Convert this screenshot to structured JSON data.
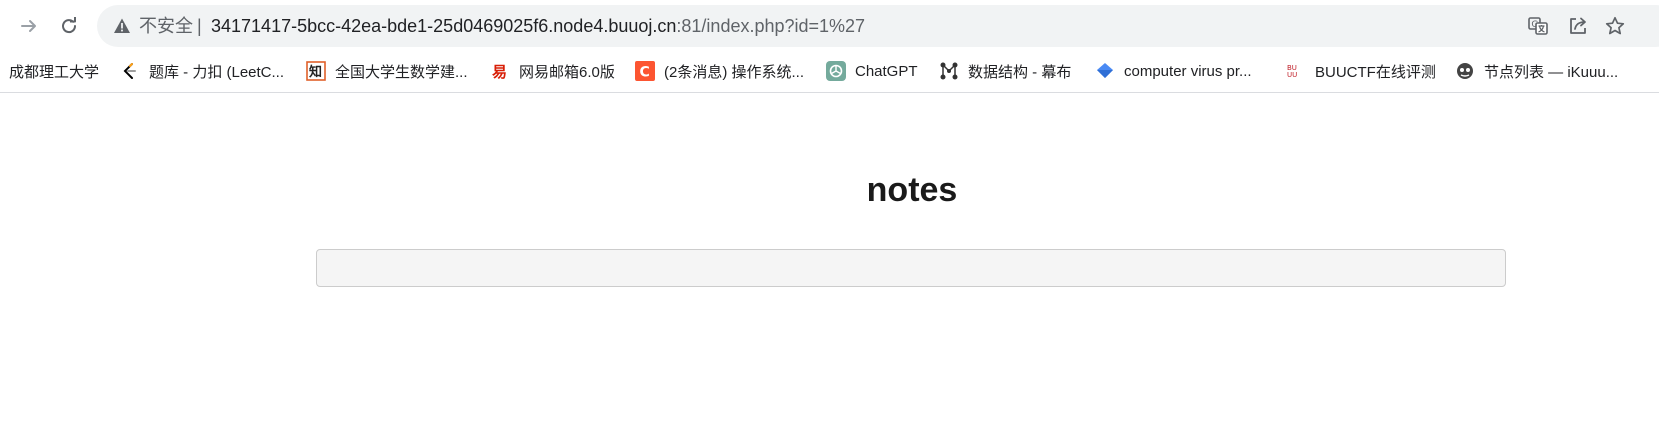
{
  "browser": {
    "security_label": "不安全",
    "separator": "|",
    "url_host": "34171417-5bcc-42ea-bde1-25d0469025f6.node4.buuoj.cn",
    "url_path": ":81/index.php?id=1%27",
    "icons": {
      "back": "arrow-right-icon",
      "reload": "reload-icon",
      "warning": "warning-icon",
      "translate": "translate-icon",
      "share": "share-icon",
      "star": "star-icon"
    }
  },
  "bookmarks": [
    {
      "label": "成都理工大学",
      "icon": "none"
    },
    {
      "label": "题库 - 力扣 (LeetC...",
      "icon": "leetcode-icon"
    },
    {
      "label": "全国大学生数学建...",
      "icon": "zhi-icon"
    },
    {
      "label": "网易邮箱6.0版",
      "icon": "netease-icon"
    },
    {
      "label": "(2条消息) 操作系统...",
      "icon": "csdn-icon"
    },
    {
      "label": "ChatGPT",
      "icon": "chatgpt-icon"
    },
    {
      "label": "数据结构 - 幕布",
      "icon": "mubu-icon"
    },
    {
      "label": "computer virus pr...",
      "icon": "diamond-icon"
    },
    {
      "label": "BUUCTF在线评测",
      "icon": "buuctf-icon"
    },
    {
      "label": "节点列表 — iKuuu...",
      "icon": "ikuuu-icon"
    }
  ],
  "page": {
    "title": "notes",
    "note_value": ""
  }
}
